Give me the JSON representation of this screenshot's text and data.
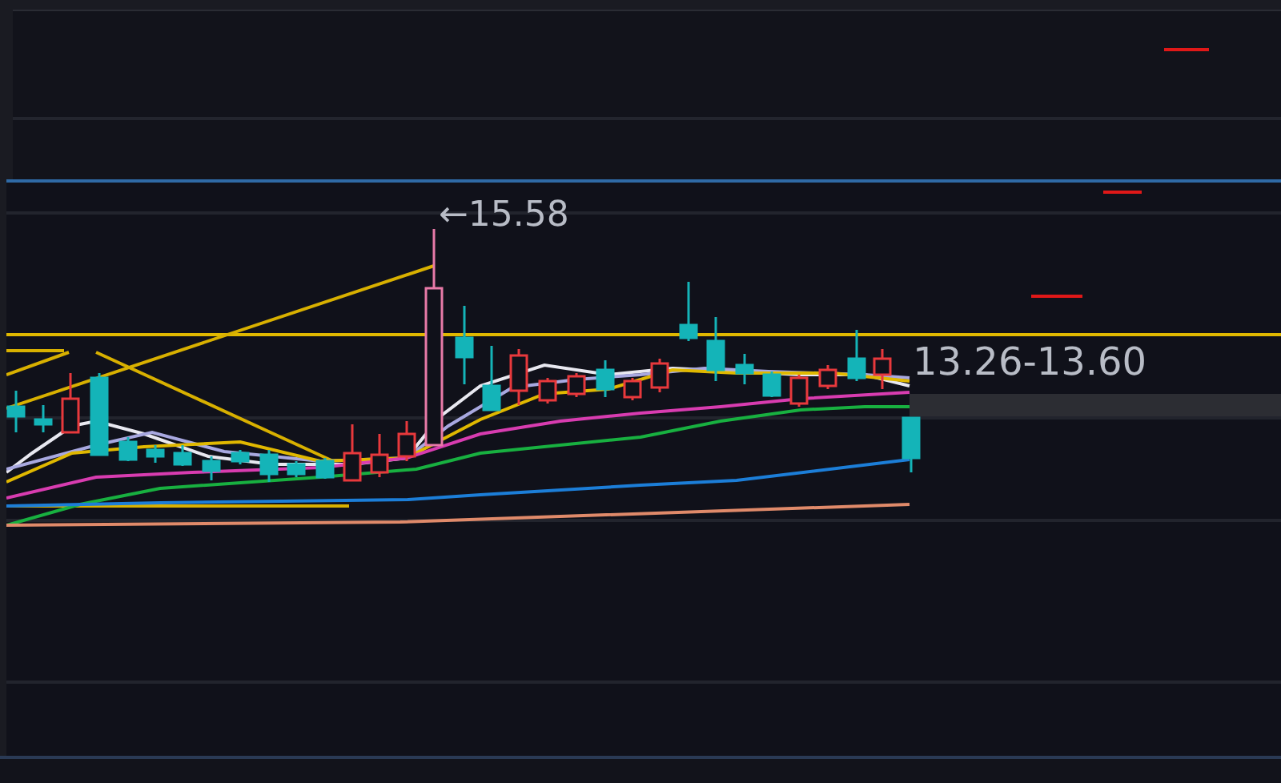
{
  "chart": {
    "peak_label": "←15.58",
    "range_label": "13.26-13.60"
  }
}
